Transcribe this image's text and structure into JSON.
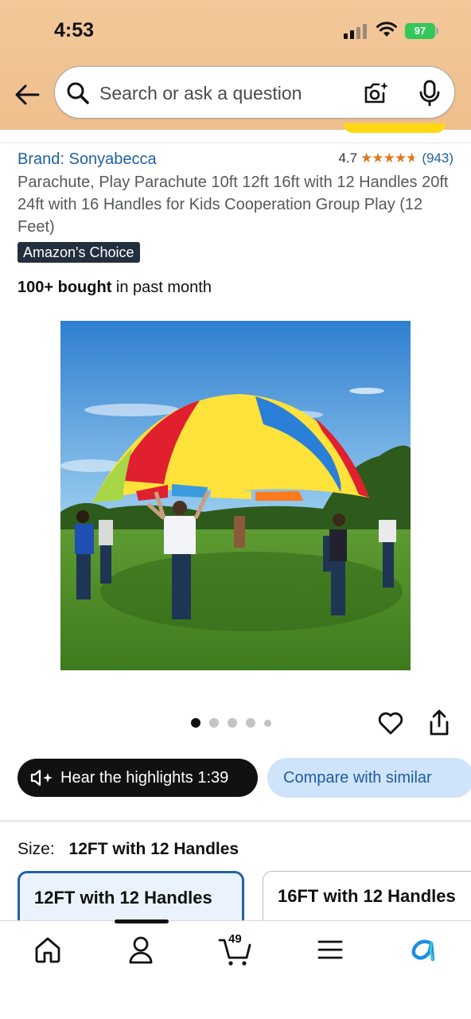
{
  "status_bar": {
    "time": "4:53",
    "battery": "97"
  },
  "search": {
    "placeholder": "Search or ask a question"
  },
  "product": {
    "brand": "Brand: Sonyabecca",
    "rating": "4.7",
    "rating_count": "(943)",
    "title": "Parachute, Play Parachute 10ft 12ft 16ft with 12 Handles 20ft 24ft with 16 Handles for Kids Cooperation Group Play (12 Feet)",
    "badge": "Amazon's Choice",
    "bought_bold": "100+ bought",
    "bought_rest": " in past month"
  },
  "gallery": {
    "image_count": 5,
    "active_index": 0
  },
  "actions": {
    "hear_label": "Hear the highlights 1:39",
    "compare_label": "Compare with similar"
  },
  "size": {
    "label": "Size:",
    "selected": "12FT with 12 Handles",
    "options": [
      "12FT with 12 Handles",
      "16FT with 12 Handles"
    ]
  },
  "bottom_nav": {
    "items": [
      "home-icon",
      "account-icon",
      "cart-icon",
      "menu-icon",
      "rufus-icon"
    ],
    "cart_count": "49"
  },
  "colors": {
    "header_bg": "#f0c08e",
    "link": "#2162a1",
    "star": "#de7921",
    "badge_bg": "#232f3e",
    "compare_bg": "#cfe3fb"
  }
}
